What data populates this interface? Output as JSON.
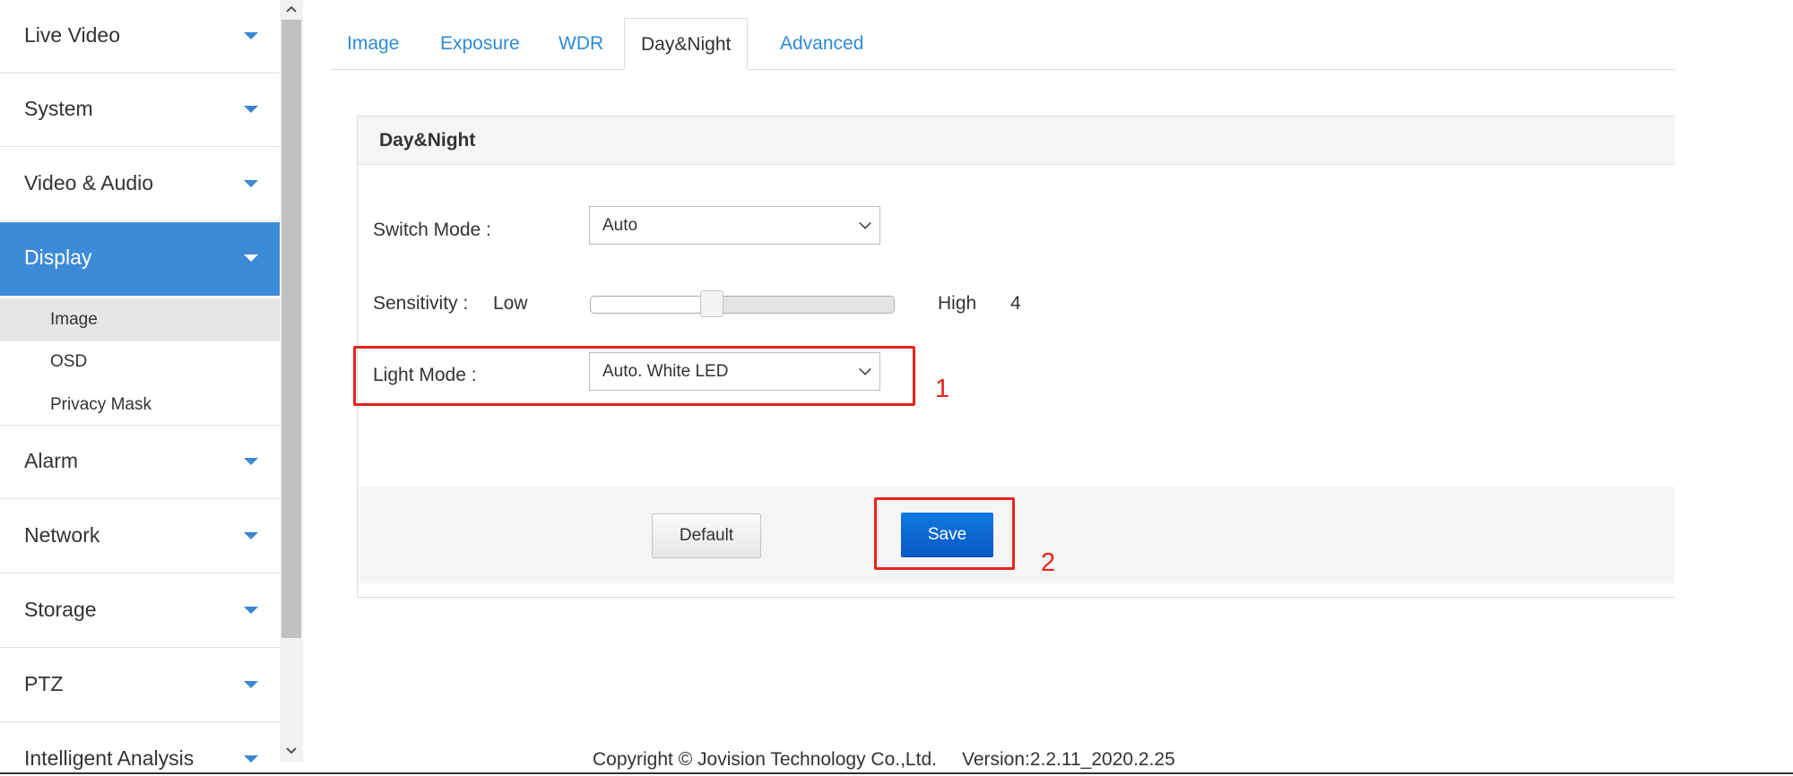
{
  "sidebar": {
    "items": [
      {
        "label": "Live Video"
      },
      {
        "label": "System"
      },
      {
        "label": "Video & Audio"
      },
      {
        "label": "Display"
      },
      {
        "label": "Alarm"
      },
      {
        "label": "Network"
      },
      {
        "label": "Storage"
      },
      {
        "label": "PTZ"
      },
      {
        "label": "Intelligent Analysis"
      }
    ],
    "active_item": "Display",
    "sub_items": [
      {
        "label": "Image"
      },
      {
        "label": "OSD"
      },
      {
        "label": "Privacy Mask"
      }
    ],
    "selected_sub_item": "Image"
  },
  "tabs": [
    {
      "label": "Image"
    },
    {
      "label": "Exposure"
    },
    {
      "label": "WDR"
    },
    {
      "label": "Day&Night"
    },
    {
      "label": "Advanced"
    }
  ],
  "active_tab": "Day&Night",
  "panel": {
    "title": "Day&Night",
    "switch_mode": {
      "label": "Switch Mode :",
      "value": "Auto"
    },
    "sensitivity": {
      "label": "Sensitivity :",
      "low_label": "Low",
      "high_label": "High",
      "value": "4",
      "fraction": 0.4
    },
    "light_mode": {
      "label": "Light Mode :",
      "value": "Auto. White LED"
    },
    "buttons": {
      "default_label": "Default",
      "save_label": "Save"
    }
  },
  "annotations": {
    "marker_1": "1",
    "marker_2": "2",
    "color": "#e8231c"
  },
  "footer": {
    "copyright": "Copyright © Jovision Technology Co.,Ltd.",
    "version": "Version:2.2.11_2020.2.25"
  },
  "colors": {
    "accent": "#3d8bd6",
    "link": "#2f8ad2",
    "save_button": "#0a63d0"
  }
}
